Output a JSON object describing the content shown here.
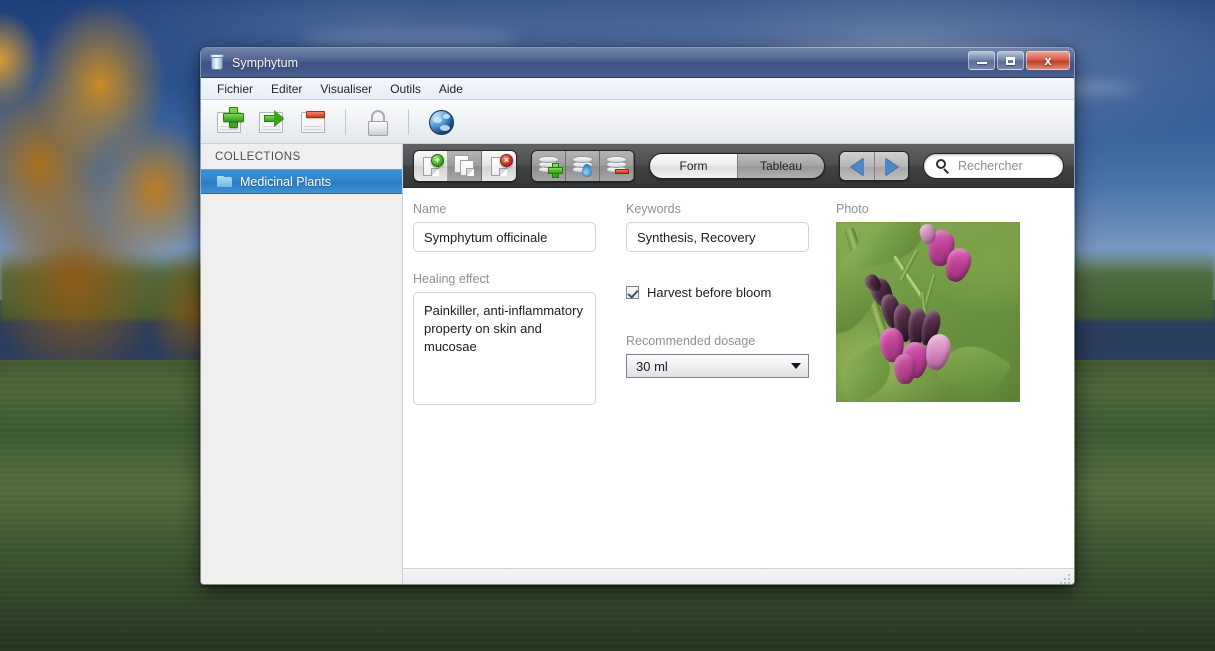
{
  "window": {
    "title": "Symphytum",
    "app_icon": "jar-icon",
    "caption": {
      "minimize_label": "–",
      "maximize_label": "□",
      "close_label": "x",
      "close_color": "#c4391f"
    }
  },
  "menubar": {
    "items": [
      {
        "label": "Fichier",
        "name": "menu-fichier"
      },
      {
        "label": "Editer",
        "name": "menu-editer"
      },
      {
        "label": "Visualiser",
        "name": "menu-visualiser"
      },
      {
        "label": "Outils",
        "name": "menu-outils"
      },
      {
        "label": "Aide",
        "name": "menu-aide"
      }
    ]
  },
  "main_toolbar": {
    "buttons": [
      {
        "icon": "document-add-icon",
        "name": "toolbar-new-collection"
      },
      {
        "icon": "document-arrow-icon",
        "name": "toolbar-modify-collection"
      },
      {
        "icon": "document-remove-icon",
        "name": "toolbar-delete-collection"
      },
      {
        "icon": "lock-icon",
        "name": "toolbar-lock"
      },
      {
        "icon": "globe-icon",
        "name": "toolbar-sync"
      }
    ]
  },
  "sidebar": {
    "header": "COLLECTIONS",
    "items": [
      {
        "label": "Medicinal Plants",
        "icon": "folder-icon",
        "selected": true
      }
    ],
    "selected_color": "#2f82c9"
  },
  "inner_toolbar": {
    "record_buttons": [
      {
        "icon": "page-add-icon",
        "name": "record-new-button"
      },
      {
        "icon": "page-duplicate-icon",
        "name": "record-duplicate-button"
      },
      {
        "icon": "page-delete-icon",
        "name": "record-delete-button"
      }
    ],
    "field_buttons": [
      {
        "icon": "database-add-icon",
        "name": "field-add-button"
      },
      {
        "icon": "database-edit-icon",
        "name": "field-edit-button"
      },
      {
        "icon": "database-remove-icon",
        "name": "field-remove-button"
      }
    ],
    "view_toggle": [
      {
        "label": "Form",
        "active": true
      },
      {
        "label": "Tableau",
        "active": false
      }
    ],
    "navigation": [
      {
        "icon": "arrow-left-icon",
        "name": "prev-record-button"
      },
      {
        "icon": "arrow-right-icon",
        "name": "next-record-button"
      }
    ],
    "search": {
      "placeholder": "Rechercher",
      "value": "",
      "icon": "search-icon"
    }
  },
  "form": {
    "fields": [
      {
        "label": "Name",
        "value": "Symphytum officinale",
        "type": "text"
      },
      {
        "label": "Keywords",
        "value": "Synthesis, Recovery",
        "type": "text"
      },
      {
        "label": "Healing effect",
        "value": "Painkiller, anti-inflammatory property on skin and mucosae",
        "type": "textarea"
      },
      {
        "label": "Harvest before bloom",
        "value": "checked",
        "type": "checkbox"
      },
      {
        "label": "Recommended dosage",
        "value": "30 ml",
        "type": "combobox"
      },
      {
        "label": "Photo",
        "value": "comfrey-flower-image",
        "type": "image"
      }
    ],
    "name_label": "Name",
    "name_value": "Symphytum officinale",
    "keywords_label": "Keywords",
    "keywords_value": "Synthesis, Recovery",
    "healing_label": "Healing effect",
    "healing_value": "Painkiller, anti-inflammatory property on skin and mucosae",
    "checkbox_label": "Harvest before bloom",
    "dosage_label": "Recommended dosage",
    "dosage_value": "30 ml",
    "photo_label": "Photo"
  },
  "statusbar": {
    "resize_grip": "resize-grip-icon"
  }
}
